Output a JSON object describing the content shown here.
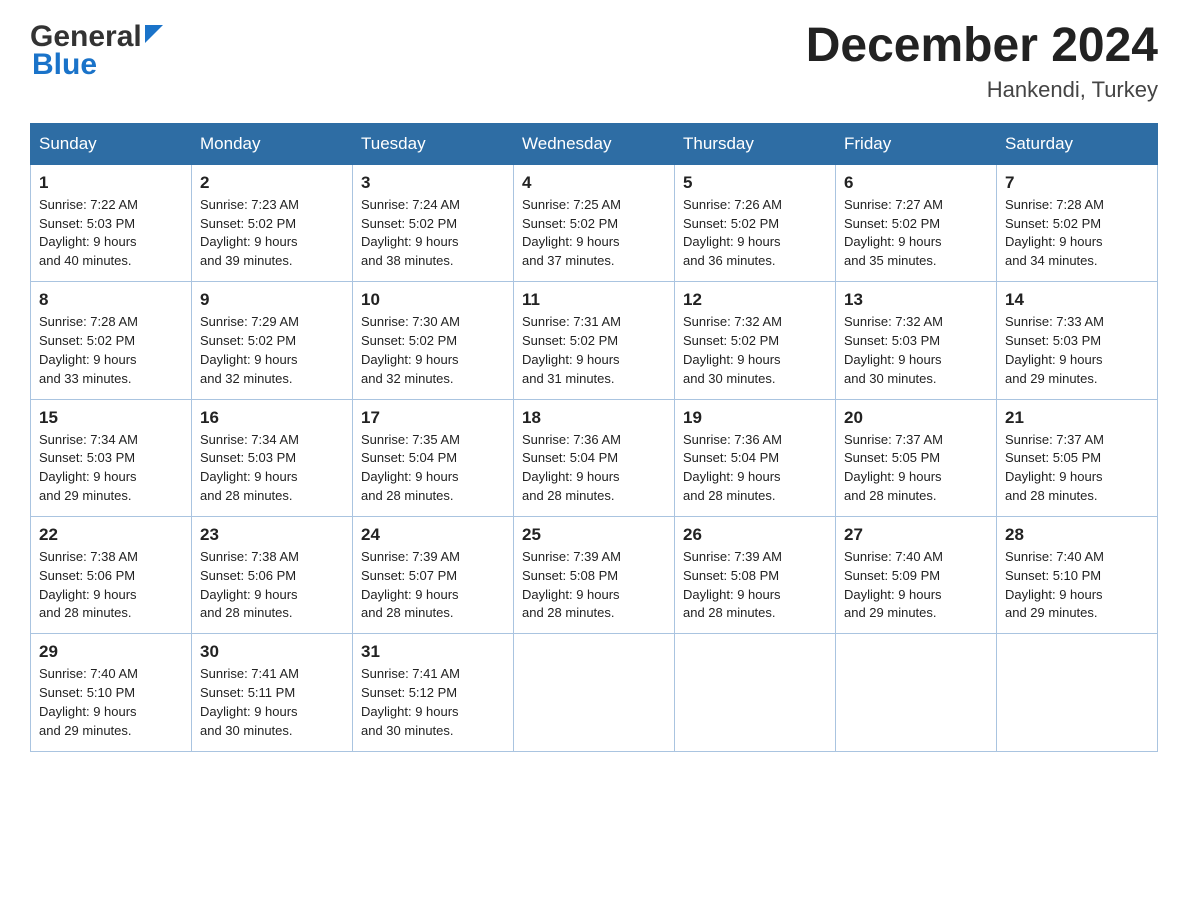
{
  "header": {
    "logo_general": "General",
    "logo_blue": "Blue",
    "month_title": "December 2024",
    "location": "Hankendi, Turkey"
  },
  "weekdays": [
    "Sunday",
    "Monday",
    "Tuesday",
    "Wednesday",
    "Thursday",
    "Friday",
    "Saturday"
  ],
  "weeks": [
    [
      {
        "day": "1",
        "sunrise": "7:22 AM",
        "sunset": "5:03 PM",
        "daylight": "9 hours and 40 minutes."
      },
      {
        "day": "2",
        "sunrise": "7:23 AM",
        "sunset": "5:02 PM",
        "daylight": "9 hours and 39 minutes."
      },
      {
        "day": "3",
        "sunrise": "7:24 AM",
        "sunset": "5:02 PM",
        "daylight": "9 hours and 38 minutes."
      },
      {
        "day": "4",
        "sunrise": "7:25 AM",
        "sunset": "5:02 PM",
        "daylight": "9 hours and 37 minutes."
      },
      {
        "day": "5",
        "sunrise": "7:26 AM",
        "sunset": "5:02 PM",
        "daylight": "9 hours and 36 minutes."
      },
      {
        "day": "6",
        "sunrise": "7:27 AM",
        "sunset": "5:02 PM",
        "daylight": "9 hours and 35 minutes."
      },
      {
        "day": "7",
        "sunrise": "7:28 AM",
        "sunset": "5:02 PM",
        "daylight": "9 hours and 34 minutes."
      }
    ],
    [
      {
        "day": "8",
        "sunrise": "7:28 AM",
        "sunset": "5:02 PM",
        "daylight": "9 hours and 33 minutes."
      },
      {
        "day": "9",
        "sunrise": "7:29 AM",
        "sunset": "5:02 PM",
        "daylight": "9 hours and 32 minutes."
      },
      {
        "day": "10",
        "sunrise": "7:30 AM",
        "sunset": "5:02 PM",
        "daylight": "9 hours and 32 minutes."
      },
      {
        "day": "11",
        "sunrise": "7:31 AM",
        "sunset": "5:02 PM",
        "daylight": "9 hours and 31 minutes."
      },
      {
        "day": "12",
        "sunrise": "7:32 AM",
        "sunset": "5:02 PM",
        "daylight": "9 hours and 30 minutes."
      },
      {
        "day": "13",
        "sunrise": "7:32 AM",
        "sunset": "5:03 PM",
        "daylight": "9 hours and 30 minutes."
      },
      {
        "day": "14",
        "sunrise": "7:33 AM",
        "sunset": "5:03 PM",
        "daylight": "9 hours and 29 minutes."
      }
    ],
    [
      {
        "day": "15",
        "sunrise": "7:34 AM",
        "sunset": "5:03 PM",
        "daylight": "9 hours and 29 minutes."
      },
      {
        "day": "16",
        "sunrise": "7:34 AM",
        "sunset": "5:03 PM",
        "daylight": "9 hours and 28 minutes."
      },
      {
        "day": "17",
        "sunrise": "7:35 AM",
        "sunset": "5:04 PM",
        "daylight": "9 hours and 28 minutes."
      },
      {
        "day": "18",
        "sunrise": "7:36 AM",
        "sunset": "5:04 PM",
        "daylight": "9 hours and 28 minutes."
      },
      {
        "day": "19",
        "sunrise": "7:36 AM",
        "sunset": "5:04 PM",
        "daylight": "9 hours and 28 minutes."
      },
      {
        "day": "20",
        "sunrise": "7:37 AM",
        "sunset": "5:05 PM",
        "daylight": "9 hours and 28 minutes."
      },
      {
        "day": "21",
        "sunrise": "7:37 AM",
        "sunset": "5:05 PM",
        "daylight": "9 hours and 28 minutes."
      }
    ],
    [
      {
        "day": "22",
        "sunrise": "7:38 AM",
        "sunset": "5:06 PM",
        "daylight": "9 hours and 28 minutes."
      },
      {
        "day": "23",
        "sunrise": "7:38 AM",
        "sunset": "5:06 PM",
        "daylight": "9 hours and 28 minutes."
      },
      {
        "day": "24",
        "sunrise": "7:39 AM",
        "sunset": "5:07 PM",
        "daylight": "9 hours and 28 minutes."
      },
      {
        "day": "25",
        "sunrise": "7:39 AM",
        "sunset": "5:08 PM",
        "daylight": "9 hours and 28 minutes."
      },
      {
        "day": "26",
        "sunrise": "7:39 AM",
        "sunset": "5:08 PM",
        "daylight": "9 hours and 28 minutes."
      },
      {
        "day": "27",
        "sunrise": "7:40 AM",
        "sunset": "5:09 PM",
        "daylight": "9 hours and 29 minutes."
      },
      {
        "day": "28",
        "sunrise": "7:40 AM",
        "sunset": "5:10 PM",
        "daylight": "9 hours and 29 minutes."
      }
    ],
    [
      {
        "day": "29",
        "sunrise": "7:40 AM",
        "sunset": "5:10 PM",
        "daylight": "9 hours and 29 minutes."
      },
      {
        "day": "30",
        "sunrise": "7:41 AM",
        "sunset": "5:11 PM",
        "daylight": "9 hours and 30 minutes."
      },
      {
        "day": "31",
        "sunrise": "7:41 AM",
        "sunset": "5:12 PM",
        "daylight": "9 hours and 30 minutes."
      },
      null,
      null,
      null,
      null
    ]
  ],
  "labels": {
    "sunrise": "Sunrise: ",
    "sunset": "Sunset: ",
    "daylight": "Daylight: "
  }
}
